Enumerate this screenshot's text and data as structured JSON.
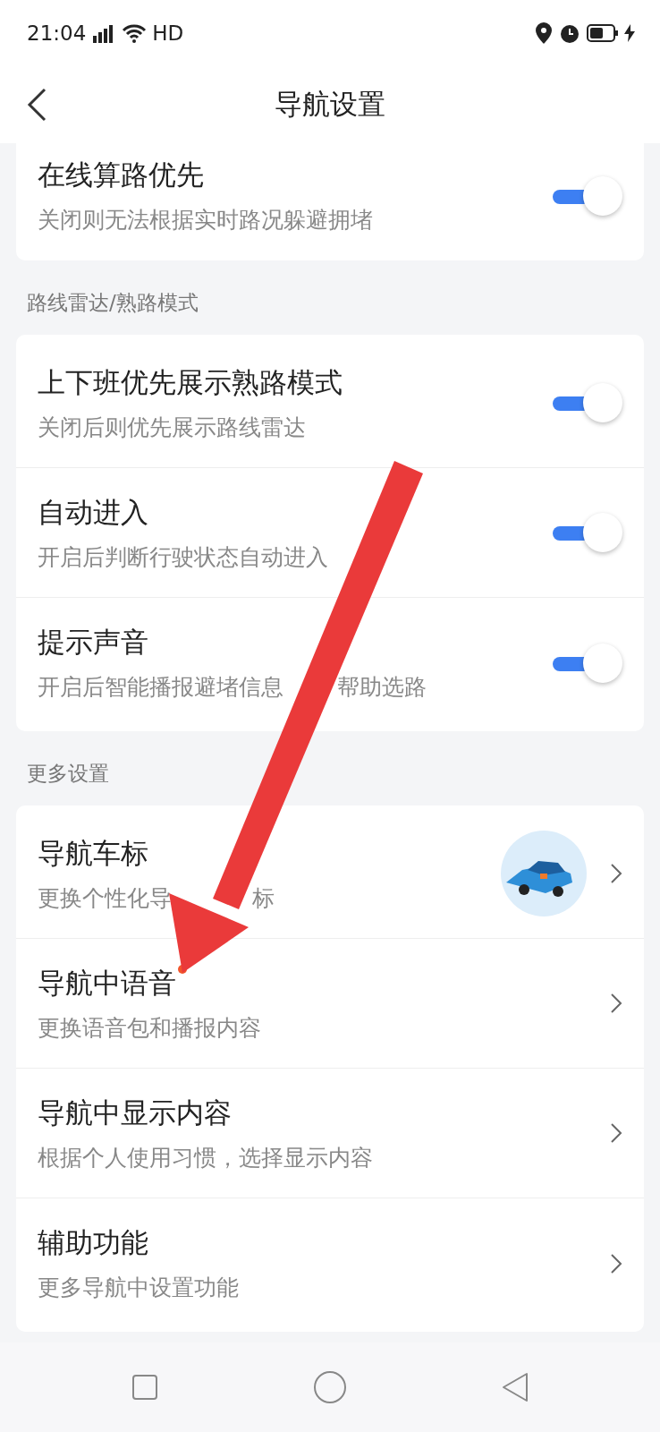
{
  "status_bar": {
    "time": "21:04",
    "network": "HD"
  },
  "header": {
    "title": "导航设置"
  },
  "sections": [
    {
      "items": [
        {
          "kind": "toggle",
          "title": "在线算路优先",
          "subtitle": "关闭则无法根据实时路况躲避拥堵",
          "on": true
        }
      ]
    },
    {
      "label": "路线雷达/熟路模式",
      "items": [
        {
          "kind": "toggle",
          "title": "上下班优先展示熟路模式",
          "subtitle": "关闭后则优先展示路线雷达",
          "on": true
        },
        {
          "kind": "toggle",
          "title": "自动进入",
          "subtitle": "开启后判断行驶状态自动进入",
          "on": true
        },
        {
          "kind": "toggle",
          "title": "提示声音",
          "subtitle_parts": [
            "开启后智能播报避堵信息",
            "帮助选路"
          ],
          "on": true
        }
      ]
    },
    {
      "label": "更多设置",
      "items": [
        {
          "kind": "car",
          "title": "导航车标",
          "subtitle_parts": [
            "更换个性化导",
            "标"
          ],
          "new": false
        },
        {
          "kind": "link",
          "title": "导航中语音",
          "subtitle": "更换语音包和播报内容",
          "new": true
        },
        {
          "kind": "link",
          "title": "导航中显示内容",
          "subtitle": "根据个人使用习惯，选择显示内容",
          "new": false
        },
        {
          "kind": "link",
          "title": "辅助功能",
          "subtitle": "更多导航中设置功能",
          "new": false
        }
      ]
    }
  ]
}
